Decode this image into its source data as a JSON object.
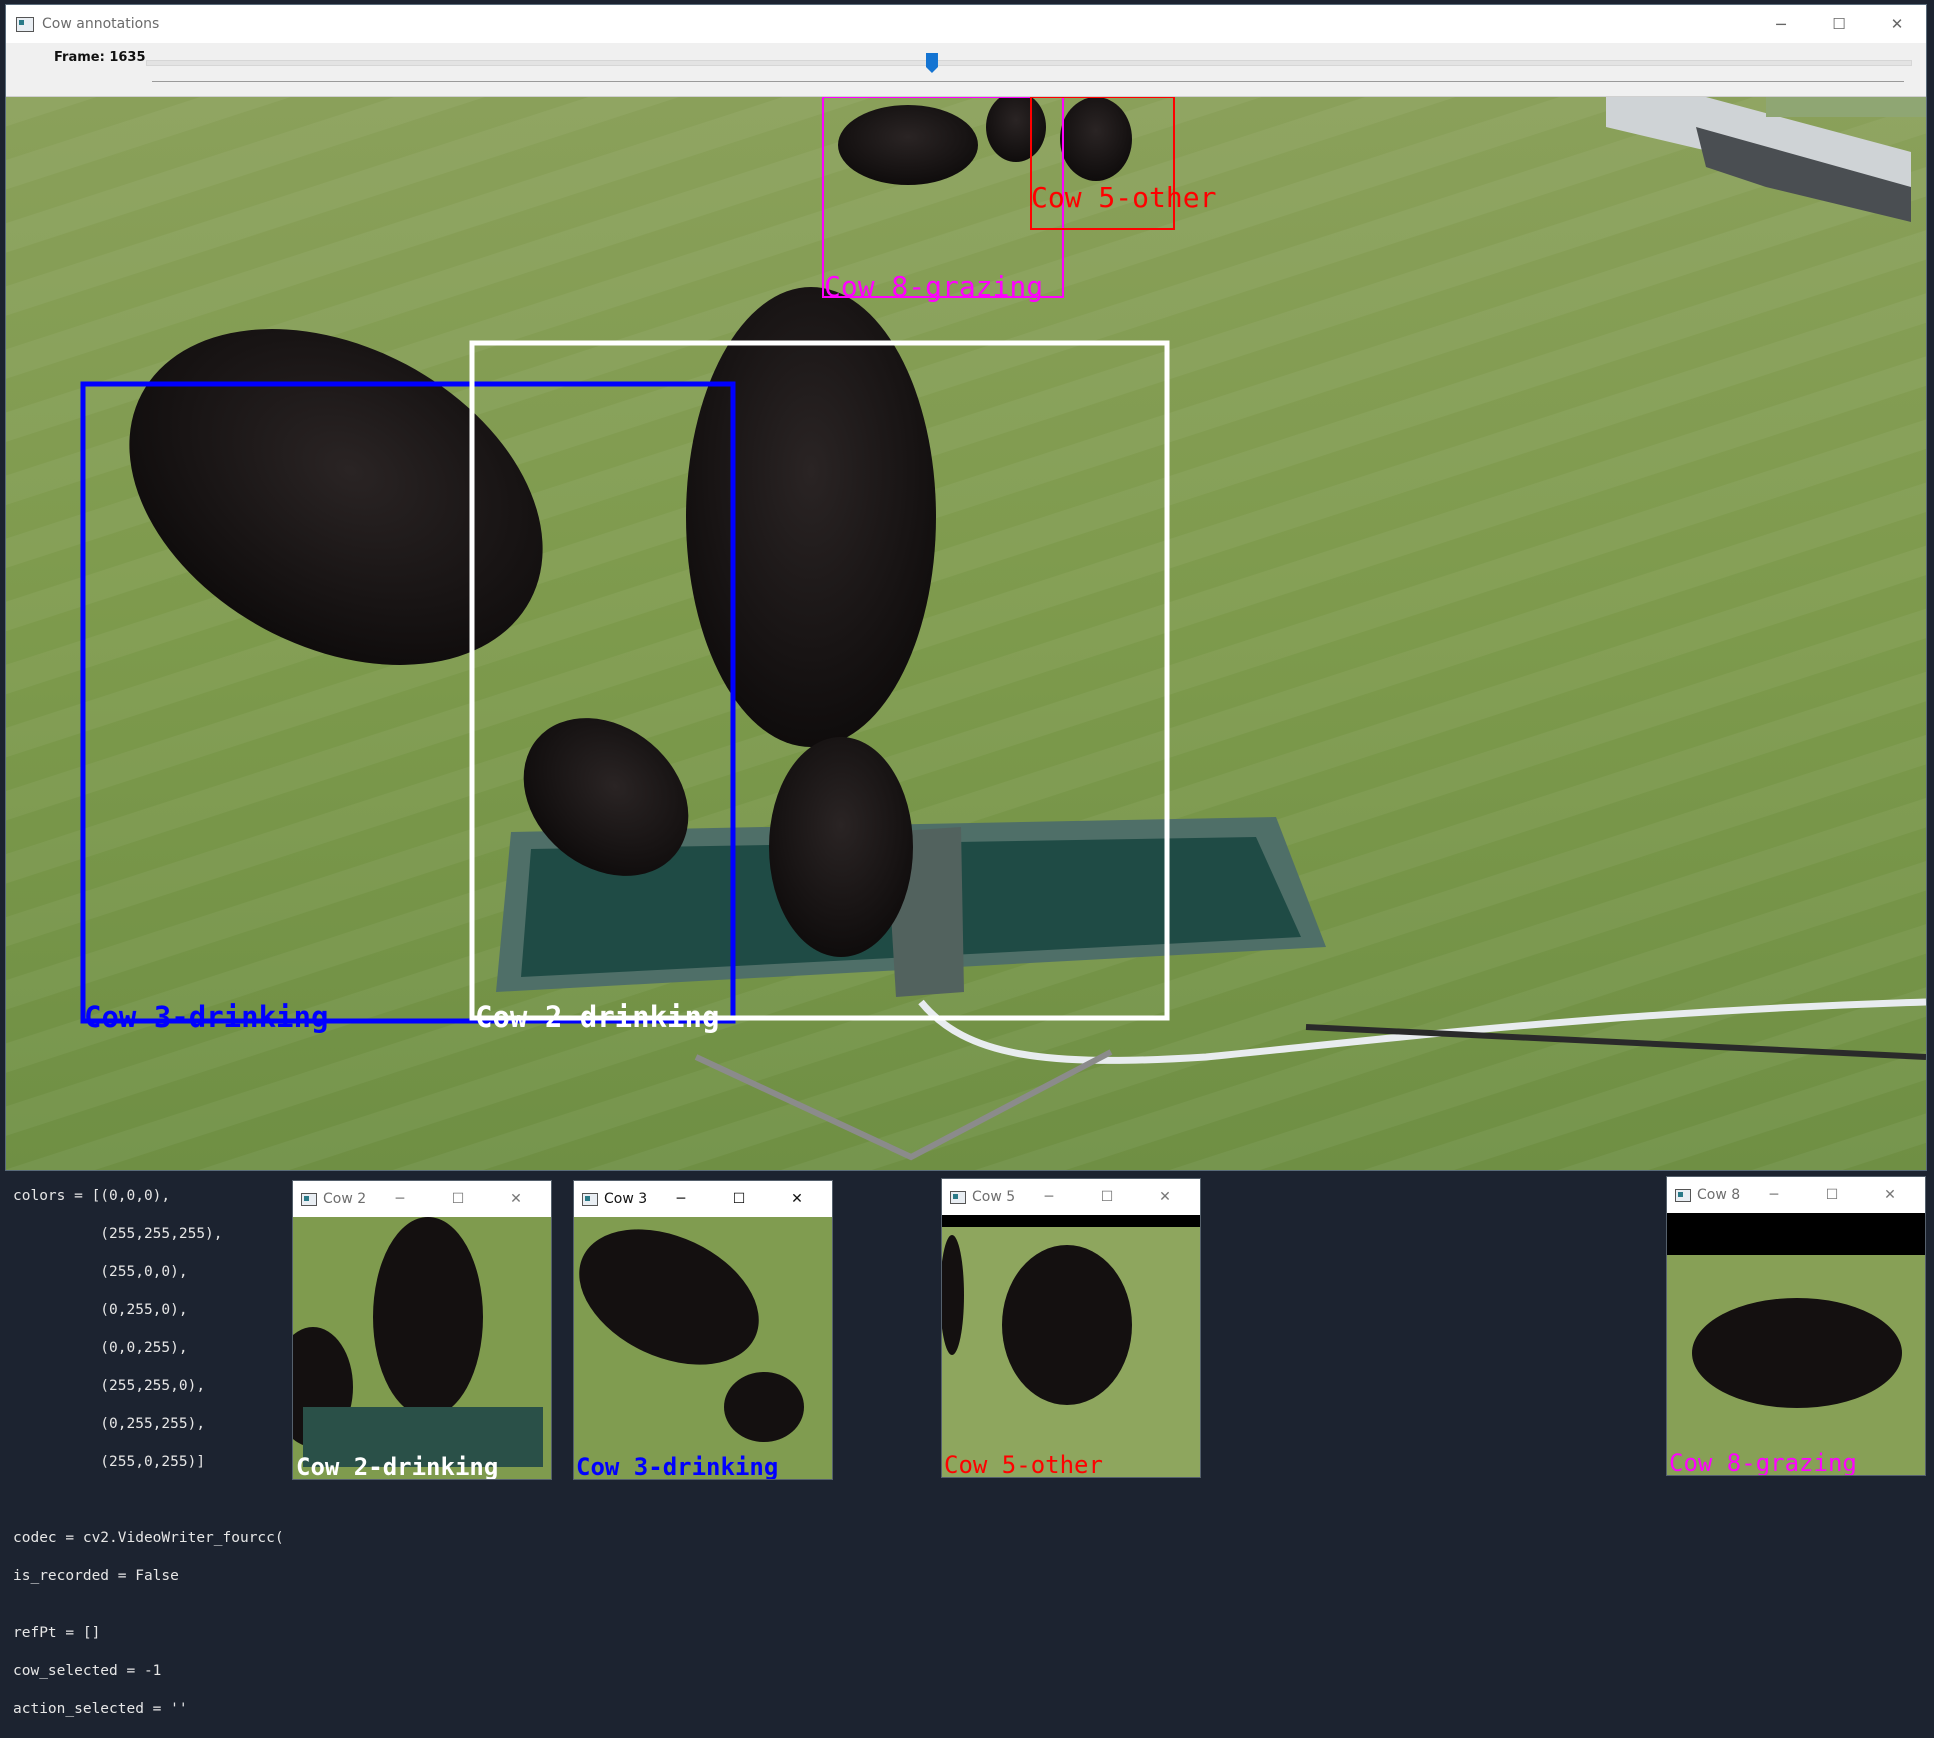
{
  "main_window": {
    "title": "Cow annotations",
    "frame_label": "Frame: 1635",
    "slider_fraction": 0.445,
    "controls": {
      "minimize": "─",
      "maximize": "☐",
      "close": "✕"
    }
  },
  "annotations": [
    {
      "label": "Cow 8-grazing",
      "color": "#ff00ff"
    },
    {
      "label": "Cow 5-other",
      "color": "#ff0000"
    },
    {
      "label": "Cow 3-drinking",
      "color": "#0000ff"
    },
    {
      "label": "Cow 2-drinking",
      "color": "#ffffff"
    }
  ],
  "crop_windows": [
    {
      "title": "Cow 2",
      "label": "Cow 2-drinking",
      "color": "#ffffff"
    },
    {
      "title": "Cow 3",
      "label": "Cow 3-drinking",
      "color": "#0000ff"
    },
    {
      "title": "Cow 5",
      "label": "Cow 5-other",
      "color": "#ff0000"
    },
    {
      "title": "Cow 8",
      "label": "Cow 8-grazing",
      "color": "#ff00ff"
    }
  ],
  "code_editor": {
    "lines": [
      "colors = [(0,0,0),",
      "          (255,255,255),",
      "          (255,0,0),",
      "          (0,255,0),",
      "          (0,0,255),",
      "          (255,255,0),",
      "          (0,255,255),",
      "          (255,0,255)]",
      "",
      "",
      "codec = cv2.VideoWriter_fourcc(",
      "is_recorded = False",
      "",
      "refPt = []",
      "cow_selected = -1",
      "action_selected = ''"
    ]
  }
}
